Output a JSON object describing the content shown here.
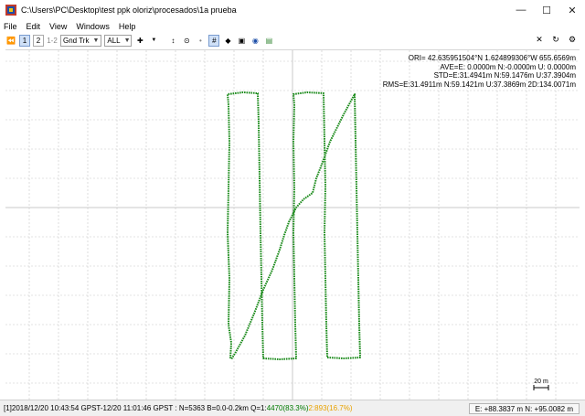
{
  "window": {
    "title": "C:\\Users\\PC\\Desktop\\test ppk oloriz\\procesados\\1a prueba"
  },
  "menu": [
    "File",
    "Edit",
    "View",
    "Windows",
    "Help"
  ],
  "toolbar": {
    "btn1": "1",
    "btn2": "2",
    "btn12": "1-2",
    "plot_type": "Gnd Trk",
    "sat_select": "ALL"
  },
  "info": {
    "ori": "ORI= 42.635951504°N    1.624899306°W 655.6569m",
    "ave": "AVE=E: 0.0000m N:-0.0000m U: 0.0000m",
    "std": "STD=E:31.4941m N:59.1476m U:37.3904m",
    "rms": "RMS=E:31.4911m N:59.1421m U:37.3869m 2D:134.0071m"
  },
  "scale": {
    "label": "20 m"
  },
  "status": {
    "left": "[1]2018/12/20 10:43:54 GPST-12/20 11:01:46 GPST : N=5363 B=0.0-0.2km Q=1:",
    "q1": "4470(83.3%)",
    "sep": " ",
    "q2": "2:893(16.7%)",
    "right": "E: +88.3837 m N: +95.0082 m"
  },
  "colors": {
    "track": "#1a8a1a",
    "grid": "#c8c8c8",
    "accent": "#7a9ccf"
  },
  "icons": [
    "stop-icon",
    "crosshair-icon",
    "range-icon",
    "center-icon",
    "grid-icon",
    "dot-icon",
    "map-icon",
    "globe-icon",
    "layers-icon",
    "close-icon",
    "refresh-icon",
    "gear-icon"
  ]
}
